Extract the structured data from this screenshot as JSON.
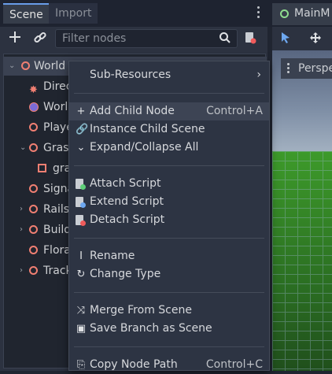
{
  "dock": {
    "tab_scene": "Scene",
    "tab_import": "Import"
  },
  "scene_toolbar": {
    "add_icon": "+",
    "link_icon": "🔗",
    "filter_placeholder": "Filter nodes",
    "search_icon": "🔍"
  },
  "tree": {
    "items": [
      {
        "label": "World",
        "icon": "node-icon"
      },
      {
        "label": "Direc",
        "icon": "light-icon"
      },
      {
        "label": "Worl",
        "icon": "world-env-icon"
      },
      {
        "label": "Playe",
        "icon": "node-icon"
      },
      {
        "label": "Gras",
        "icon": "node-icon"
      },
      {
        "label": "gra",
        "icon": "mesh-icon"
      },
      {
        "label": "Signa",
        "icon": "node-icon"
      },
      {
        "label": "Rails",
        "icon": "node-icon"
      },
      {
        "label": "Build",
        "icon": "node-icon"
      },
      {
        "label": "Flora",
        "icon": "node-icon"
      },
      {
        "label": "Track",
        "icon": "node-icon"
      }
    ]
  },
  "viewport": {
    "tab_label": "MainM",
    "perspective_label": "Perspe"
  },
  "context_menu": {
    "sub_resources": "Sub-Resources",
    "add_child_node": "Add Child Node",
    "add_child_shortcut": "Control+A",
    "instance_child_scene": "Instance Child Scene",
    "expand_collapse_all": "Expand/Collapse All",
    "attach_script": "Attach Script",
    "extend_script": "Extend Script",
    "detach_script": "Detach Script",
    "rename": "Rename",
    "change_type": "Change Type",
    "merge_from_scene": "Merge From Scene",
    "save_branch_as_scene": "Save Branch as Scene",
    "copy_node_path": "Copy Node Path",
    "copy_node_path_shortcut": "Control+C"
  },
  "colors": {
    "accent": "#699ce8",
    "node_icon": "#f07f72",
    "menu_bg": "#2d3443"
  }
}
